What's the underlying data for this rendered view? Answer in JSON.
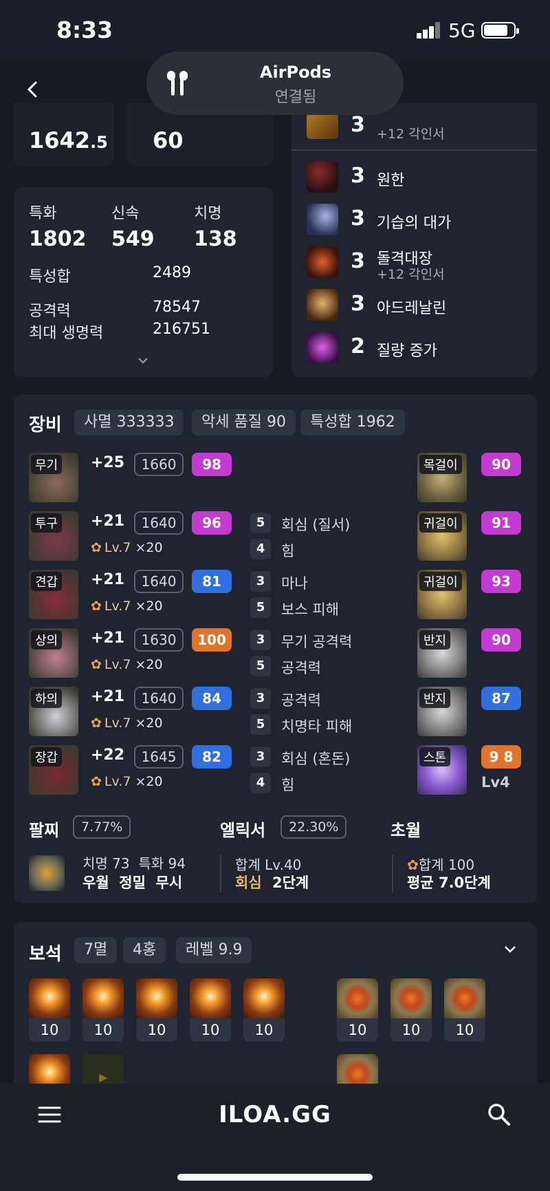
{
  "status": {
    "time": "8:33",
    "network": "5G"
  },
  "airpods": {
    "title": "AirPods",
    "subtitle": "연결됨"
  },
  "top": {
    "item_level": "1642",
    "item_level_decimal": ".5",
    "combat_level": "60"
  },
  "stats": {
    "items": [
      {
        "label": "특화",
        "value": "1802"
      },
      {
        "label": "신속",
        "value": "549"
      },
      {
        "label": "치명",
        "value": "138"
      }
    ],
    "sum_label": "특성합",
    "sum_value": "2489",
    "atk_label": "공격력",
    "atk_value": "78547",
    "hp_label": "최대 생명력",
    "hp_value": "216751"
  },
  "engravings": {
    "top_partial": {
      "level": "3",
      "sub": "+12 각인서"
    },
    "items": [
      {
        "level": "3",
        "name": "원한",
        "sub": "",
        "icon": "grudge-icon"
      },
      {
        "level": "3",
        "name": "기습의 대가",
        "sub": "",
        "icon": "ambush-icon"
      },
      {
        "level": "3",
        "name": "돌격대장",
        "sub": "+12 각인서",
        "icon": "raid-captain-icon"
      },
      {
        "level": "3",
        "name": "아드레날린",
        "sub": "",
        "icon": "adrenaline-icon"
      },
      {
        "level": "2",
        "name": "질량 증가",
        "sub": "",
        "icon": "mass-increase-icon"
      }
    ]
  },
  "equipment": {
    "title": "장비",
    "tags": [
      "사멸 333333",
      "악세 품질 90",
      "특성합 1962"
    ],
    "gear": [
      {
        "slot": "무기",
        "plus": "+25",
        "ilvl": "1660",
        "quality": "98",
        "qcolor": "#c43bd1",
        "elixir": "",
        "elixir_mult": ""
      },
      {
        "slot": "투구",
        "plus": "+21",
        "ilvl": "1640",
        "quality": "96",
        "qcolor": "#c43bd1",
        "elixir": "Lv.7",
        "elixir_mult": "×20"
      },
      {
        "slot": "견갑",
        "plus": "+21",
        "ilvl": "1640",
        "quality": "81",
        "qcolor": "#2f6fe0",
        "elixir": "Lv.7",
        "elixir_mult": "×20"
      },
      {
        "slot": "상의",
        "plus": "+21",
        "ilvl": "1630",
        "quality": "100",
        "qcolor": "#e0742b",
        "elixir": "Lv.7",
        "elixir_mult": "×20"
      },
      {
        "slot": "하의",
        "plus": "+21",
        "ilvl": "1640",
        "quality": "84",
        "qcolor": "#2f6fe0",
        "elixir": "Lv.7",
        "elixir_mult": "×20"
      },
      {
        "slot": "장갑",
        "plus": "+22",
        "ilvl": "1645",
        "quality": "82",
        "qcolor": "#2f6fe0",
        "elixir": "Lv.7",
        "elixir_mult": "×20"
      }
    ],
    "elixir_opts": [
      [],
      [
        {
          "n": "5",
          "t": "회심 (질서)"
        },
        {
          "n": "4",
          "t": "힘"
        }
      ],
      [
        {
          "n": "3",
          "t": "마나"
        },
        {
          "n": "5",
          "t": "보스 피해"
        }
      ],
      [
        {
          "n": "3",
          "t": "무기 공격력"
        },
        {
          "n": "5",
          "t": "공격력"
        }
      ],
      [
        {
          "n": "3",
          "t": "공격력"
        },
        {
          "n": "5",
          "t": "치명타 피해"
        }
      ],
      [
        {
          "n": "3",
          "t": "회심 (혼돈)"
        },
        {
          "n": "4",
          "t": "힘"
        }
      ]
    ],
    "accessories": [
      {
        "slot": "목걸이",
        "quality": "90",
        "qcolor": "#c43bd1",
        "extra": ""
      },
      {
        "slot": "귀걸이",
        "quality": "91",
        "qcolor": "#c43bd1",
        "extra": ""
      },
      {
        "slot": "귀걸이",
        "quality": "93",
        "qcolor": "#c43bd1",
        "extra": ""
      },
      {
        "slot": "반지",
        "quality": "90",
        "qcolor": "#c43bd1",
        "extra": ""
      },
      {
        "slot": "반지",
        "quality": "87",
        "qcolor": "#2f6fe0",
        "extra": ""
      },
      {
        "slot": "스톤",
        "quality": "9 8",
        "qcolor": "#e0742b",
        "extra": "Lv4"
      }
    ],
    "bracelet": {
      "title": "팔찌",
      "percent": "7.77%",
      "stats": "치명 73  특화 94",
      "effects": "우월  정밀  무시"
    },
    "elixir": {
      "title": "엘릭서",
      "percent": "22.30%",
      "total": "합계 Lv.40",
      "set_name": "회심",
      "set_level": "2단계"
    },
    "transcend": {
      "title": "초월",
      "total": "합계 100",
      "avg": "평균 7.0단계"
    }
  },
  "gems": {
    "title": "보석",
    "tags": [
      "7멸",
      "4홍",
      "레벨 9.9"
    ],
    "row1": [
      {
        "level": "10",
        "kind": "annihilation"
      },
      {
        "level": "10",
        "kind": "annihilation"
      },
      {
        "level": "10",
        "kind": "annihilation"
      },
      {
        "level": "10",
        "kind": "annihilation"
      },
      {
        "level": "10",
        "kind": "annihilation"
      },
      {
        "level": "10",
        "kind": "crimson"
      },
      {
        "level": "10",
        "kind": "crimson"
      },
      {
        "level": "10",
        "kind": "crimson"
      }
    ]
  },
  "bottom": {
    "logo": "ILOA.GG"
  }
}
